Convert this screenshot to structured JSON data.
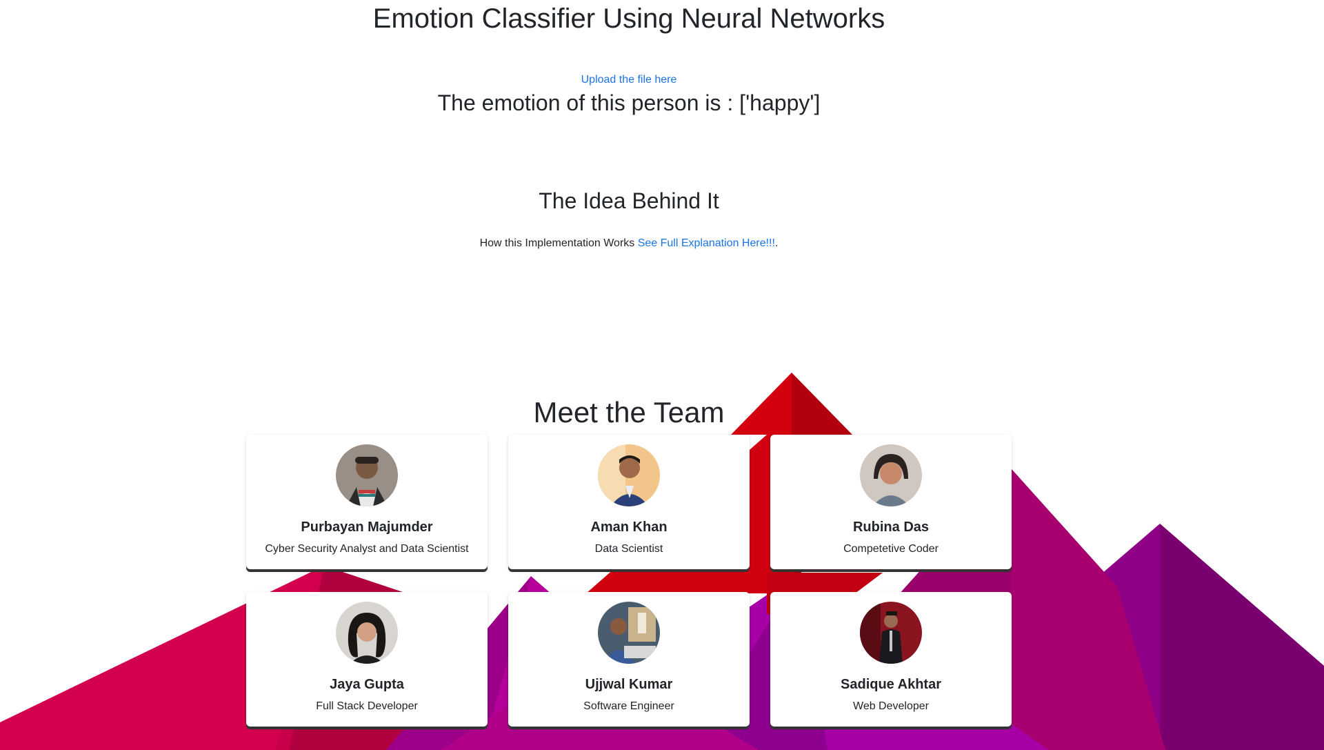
{
  "header": {
    "title": "Emotion Classifier Using Neural Networks"
  },
  "upload": {
    "link_label": "Upload the file here"
  },
  "result": {
    "text": "The emotion of this person is : ['happy']"
  },
  "idea": {
    "heading": "The Idea Behind It",
    "text_prefix": "How this Implementation Works ",
    "link_label": "See Full Explanation Here!!!",
    "text_suffix": "."
  },
  "team": {
    "heading": "Meet the Team",
    "members": [
      {
        "name": "Purbayan Majumder",
        "role": "Cyber Security Analyst and Data Scientist",
        "avatar_icon": "avatar-photo"
      },
      {
        "name": "Aman Khan",
        "role": "Data Scientist",
        "avatar_icon": "avatar-photo"
      },
      {
        "name": "Rubina Das",
        "role": "Competetive Coder",
        "avatar_icon": "avatar-photo"
      },
      {
        "name": "Jaya Gupta",
        "role": "Full Stack Developer",
        "avatar_icon": "avatar-photo"
      },
      {
        "name": "Ujjwal Kumar",
        "role": "Software Engineer",
        "avatar_icon": "avatar-photo"
      },
      {
        "name": "Sadique Akhtar",
        "role": "Web Developer",
        "avatar_icon": "avatar-photo"
      }
    ]
  },
  "colors": {
    "link": "#1a73e8",
    "text": "#212529",
    "bg_red": "#d6001c",
    "bg_crimson": "#c2004a",
    "bg_magenta": "#a4009a",
    "bg_purple": "#8a0080"
  }
}
